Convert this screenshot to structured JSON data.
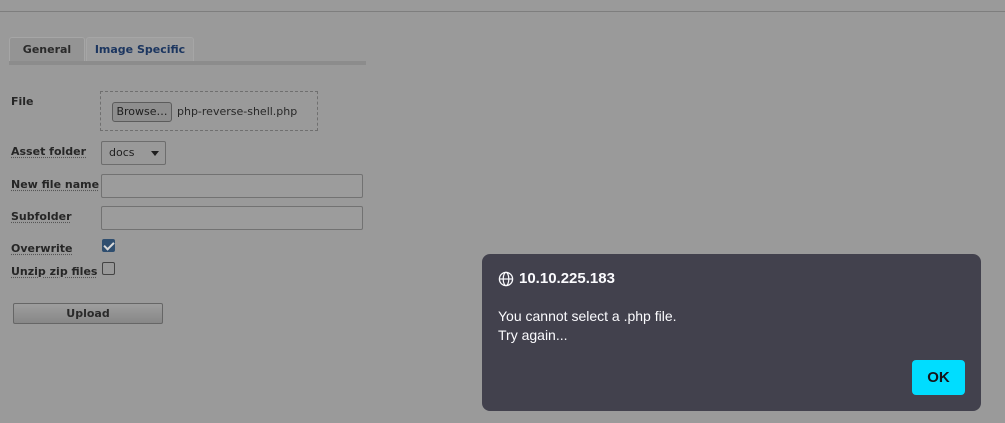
{
  "tabs": [
    {
      "label": "General",
      "active": true
    },
    {
      "label": "Image Specific",
      "active": false
    }
  ],
  "form": {
    "file_label": "File",
    "browse_label": "Browse…",
    "selected_file": "php-reverse-shell.php",
    "asset_folder_label": "Asset folder",
    "asset_folder_value": "docs",
    "new_file_name_label": "New file name",
    "new_file_name_value": "",
    "subfolder_label": "Subfolder",
    "subfolder_value": "",
    "overwrite_label": "Overwrite",
    "overwrite_checked": true,
    "unzip_label": "Unzip zip files",
    "unzip_checked": false,
    "upload_label": "Upload"
  },
  "dialog": {
    "host": "10.10.225.183",
    "message_line1": "You cannot select a .php file.",
    "message_line2": "Try again...",
    "ok_label": "OK",
    "accent_color": "#00ddff",
    "background_color": "#42414d"
  }
}
